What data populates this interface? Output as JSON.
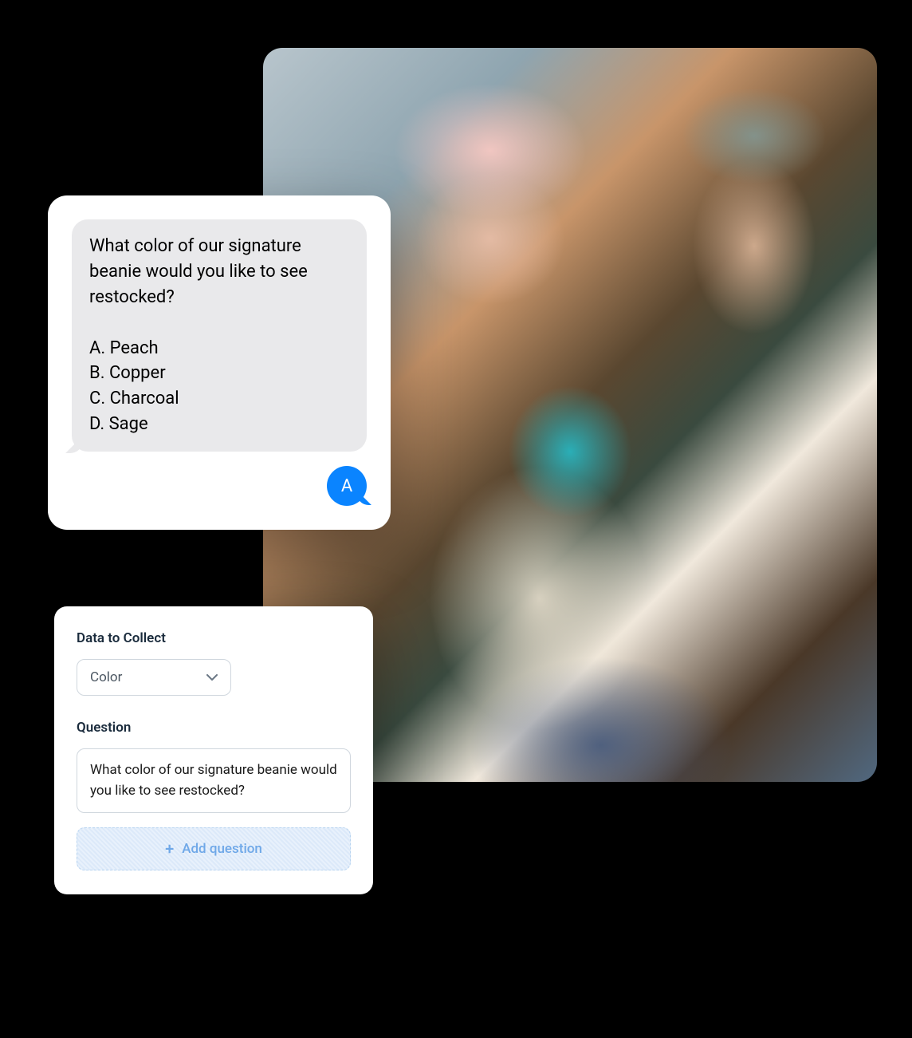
{
  "chat": {
    "incoming": "What color of our signature beanie would you like to see restocked?\n\nA. Peach\nB. Copper\nC. Charcoal\nD. Sage",
    "outgoing": "A",
    "options": [
      "Peach",
      "Copper",
      "Charcoal",
      "Sage"
    ]
  },
  "form": {
    "data_to_collect_label": "Data to Collect",
    "data_to_collect_value": "Color",
    "question_label": "Question",
    "question_value": "What color of our signature beanie would you like to see restocked?",
    "add_question_label": "Add question"
  }
}
